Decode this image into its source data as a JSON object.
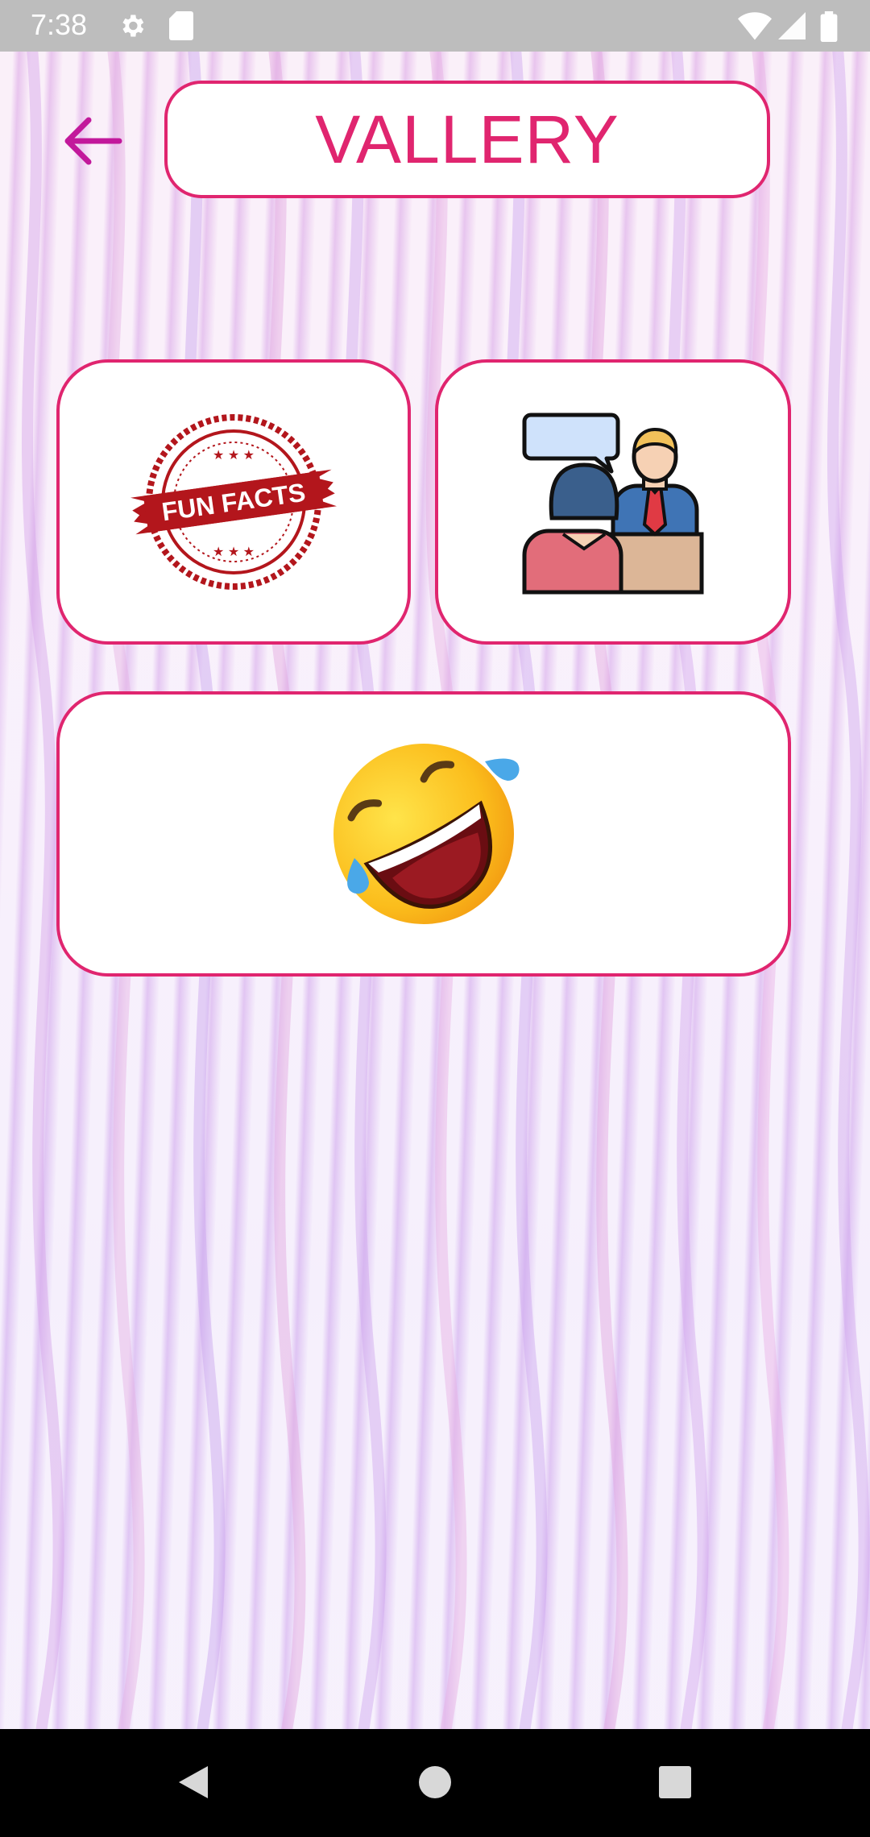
{
  "status_bar": {
    "time": "7:38",
    "icons": [
      "gear-icon",
      "sd-card-icon",
      "wifi-icon",
      "signal-icon",
      "battery-icon"
    ]
  },
  "header": {
    "back_icon": "arrow-left-icon",
    "title": "VALLERY"
  },
  "cards": [
    {
      "id": "fun-facts",
      "image": "fun-facts-stamp",
      "stamp_text": "FUN FACTS"
    },
    {
      "id": "conversation",
      "image": "conversation-people-icon"
    },
    {
      "id": "jokes",
      "image": "laughing-emoji-icon"
    }
  ],
  "nav_bar": {
    "buttons": [
      "back-triangle-icon",
      "home-circle-icon",
      "recents-square-icon"
    ]
  },
  "colors": {
    "accent": "#e0256f",
    "back_arrow": "#c2189b",
    "status_bar": "#bdbdbd",
    "nav_bar": "#000000"
  }
}
